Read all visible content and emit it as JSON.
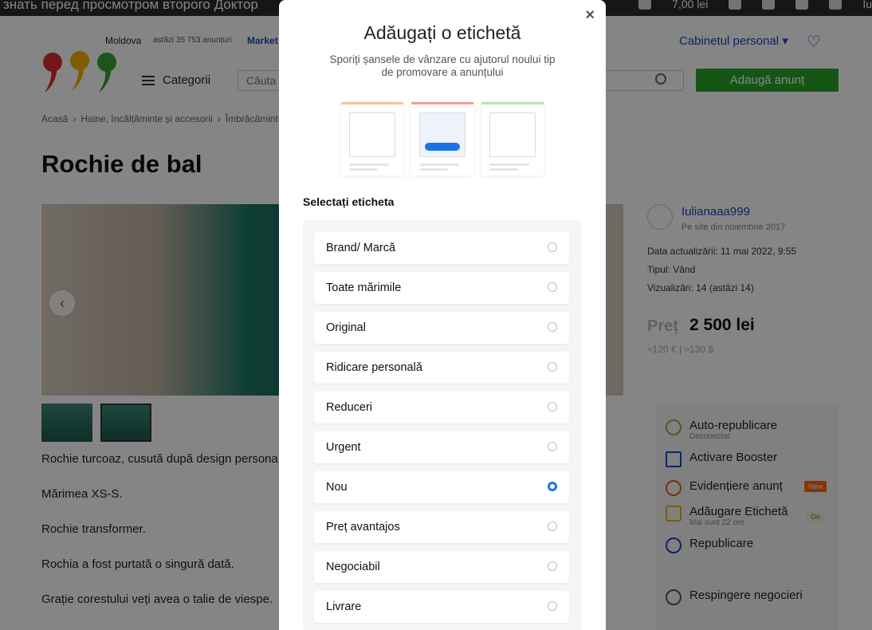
{
  "topbar": {
    "marquee": "знать перед просмотром второго Доктор",
    "balance": "7,00 lei",
    "user": "Iu"
  },
  "header": {
    "region": "Moldova",
    "ads_today": "astăzi 35 753 anunțuri",
    "market": "Market",
    "categories": "Categorii",
    "search_placeholder": "Căuta",
    "cabinet": "Cabinetul personal",
    "add_ad": "Adaugă anunț"
  },
  "breadcrumb": [
    "Acasă",
    "Haine, încălțăminte și accesorii",
    "Îmbrăcămint"
  ],
  "title": "Rochie de bal",
  "description": [
    "Rochie turcoaz, cusută după design persona",
    "Mărimea XS-S.",
    "Rochie transformer.",
    "Rochia a fost purtată o singură dată.",
    "Grație corestului veți avea o talie de viespe."
  ],
  "seller": {
    "name": "Iulianaaa999",
    "since": "Pe site din noiembrie 2017",
    "updated": "Data actualizării: 11 mai 2022, 9:55",
    "type": "Tipul: Vând",
    "views": "Vizualizări: 14 (astăzi 14)"
  },
  "price": {
    "label": "Preț",
    "value": "2 500 lei",
    "alt": "≈120 € | ≈130 $"
  },
  "promo": {
    "auto": "Auto-republicare",
    "auto_sub": "Deconectat",
    "booster": "Activare Booster",
    "highlight": "Evidențiere anunț",
    "new_badge": "New",
    "label": "Adăugare Etichetă",
    "label_sub": "Mai sunt 22 ore",
    "on_badge": "On",
    "republish": "Republicare",
    "reject": "Respingere negocieri"
  },
  "modal": {
    "title": "Adăugați o etichetă",
    "subtitle": "Sporiți șansele de vânzare cu ajutorul noului tip de promovare a anunțului",
    "select_label": "Selectați eticheta",
    "close": "×",
    "options": [
      "Brand/ Marcă",
      "Toate mărimile",
      "Original",
      "Ridicare personală",
      "Reduceri",
      "Urgent",
      "Nou",
      "Preț avantajos",
      "Negociabil",
      "Livrare"
    ],
    "selected": "Nou"
  },
  "colors": {
    "accent": "#1a73e8",
    "green": "#2aa52a",
    "link": "#1a47b8"
  }
}
